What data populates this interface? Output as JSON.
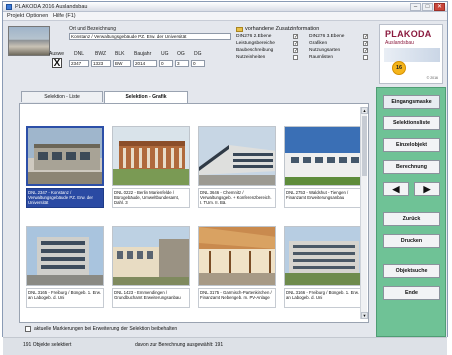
{
  "window": {
    "title": "PLAKODA 2016 Auslandsbau"
  },
  "menu": [
    "Projekt",
    "Optionen",
    "Hilfe (F1)"
  ],
  "object": {
    "label": "Ort und Bezeichnung",
    "name": "Konstanz / Verwaltungsgebäude PZ. Erw. der Universität",
    "codes_label": "Auswe",
    "columns": [
      "DNL",
      "BWZ",
      "BLK",
      "Baujahr",
      "UG",
      "OG",
      "DG"
    ],
    "values": [
      "2347",
      "1323",
      "BW",
      "2014",
      "0",
      "3",
      "0"
    ],
    "mark": "X"
  },
  "zusatz": {
    "title": "vorhandene Zusatzinformation",
    "left": [
      "DIN276 2.Ebene",
      "Leistungsbereiche",
      "Baubeschreibung",
      "Nutzeinheiten"
    ],
    "left_checked": [
      true,
      true,
      true,
      false
    ],
    "right": [
      "DIN276 3.Ebene",
      "Grafiken",
      "Nutzungsarten",
      "Raumlisten"
    ],
    "right_checked": [
      true,
      true,
      true,
      false
    ]
  },
  "logo": {
    "name": "PLAKODA",
    "sub": "Auslandsbau",
    "badge": "16",
    "small": "© 2016"
  },
  "tabs": [
    "Selektion - Liste",
    "Selektion - Grafik"
  ],
  "cards": [
    {
      "caption": "DNL 2347 - Konstanz / Verwaltungsgebäude PZ. Erw. der Universität",
      "selected": true
    },
    {
      "caption": "DNL 0222 - Berlin Marienfelde / Bürogebäude, Umweltbundesamt, Dahl. 3",
      "selected": false
    },
    {
      "caption": "DNL 3646 - Chemnitz / Verwaltungsgeb. + Konferenzbereich. I. TUm. II. Bä.",
      "selected": false
    },
    {
      "caption": "DNL 2753 - Waldshut - Tiengen / Finanzamt Erweiterungsanbau",
      "selected": false
    },
    {
      "caption": "DNL 3165 - Freiburg / Büngeb. 1. Erw. an Labogeb. d. Uni",
      "selected": false
    },
    {
      "caption": "DNL 1423 - Emmendingen / Grundbuchamt Erweiterungsanbau",
      "selected": false
    },
    {
      "caption": "DNL 3175 - Garmisch-Partenkirchen / Finanzamt Nebengeb. m. PV-Anlage",
      "selected": false
    },
    {
      "caption": "DNL 3166 - Freiburg / Büngeb. 1. Erw. an Labogeb. d. Uni",
      "selected": false
    }
  ],
  "footer": {
    "checkbox_label": "aktuelle Markierungen bei Erweiterung der Selektion beibehalten",
    "status_left": "191 Objekte selektiert",
    "status_right": "davon zur Berechnung ausgewählt:  191"
  },
  "buttons": {
    "eingabemaske": "Eingangsmaske",
    "selektionsliste": "Selektionsliste",
    "einzelobjekt": "Einzelobjekt",
    "berechnung": "Berechnung",
    "prev": "◀",
    "next": "▶",
    "zurueck": "Zurück",
    "drucken": "Drucken",
    "objektsuche": "Objektsuche",
    "ende": "Ende"
  }
}
